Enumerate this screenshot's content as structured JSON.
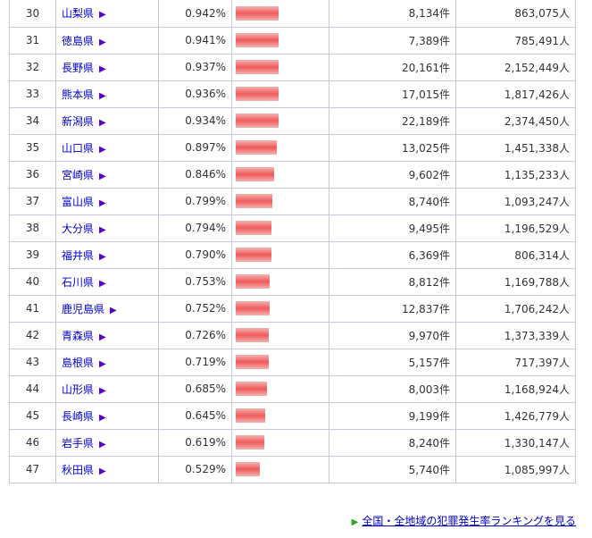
{
  "table": {
    "rows": [
      {
        "rank": "30",
        "pref": "山梨県",
        "rate": "0.942%",
        "rate_value": 0.942,
        "count": "8,134件",
        "population": "863,075人"
      },
      {
        "rank": "31",
        "pref": "徳島県",
        "rate": "0.941%",
        "rate_value": 0.941,
        "count": "7,389件",
        "population": "785,491人"
      },
      {
        "rank": "32",
        "pref": "長野県",
        "rate": "0.937%",
        "rate_value": 0.937,
        "count": "20,161件",
        "population": "2,152,449人"
      },
      {
        "rank": "33",
        "pref": "熊本県",
        "rate": "0.936%",
        "rate_value": 0.936,
        "count": "17,015件",
        "population": "1,817,426人"
      },
      {
        "rank": "34",
        "pref": "新潟県",
        "rate": "0.934%",
        "rate_value": 0.934,
        "count": "22,189件",
        "population": "2,374,450人"
      },
      {
        "rank": "35",
        "pref": "山口県",
        "rate": "0.897%",
        "rate_value": 0.897,
        "count": "13,025件",
        "population": "1,451,338人"
      },
      {
        "rank": "36",
        "pref": "宮崎県",
        "rate": "0.846%",
        "rate_value": 0.846,
        "count": "9,602件",
        "population": "1,135,233人"
      },
      {
        "rank": "37",
        "pref": "富山県",
        "rate": "0.799%",
        "rate_value": 0.799,
        "count": "8,740件",
        "population": "1,093,247人"
      },
      {
        "rank": "38",
        "pref": "大分県",
        "rate": "0.794%",
        "rate_value": 0.794,
        "count": "9,495件",
        "population": "1,196,529人"
      },
      {
        "rank": "39",
        "pref": "福井県",
        "rate": "0.790%",
        "rate_value": 0.79,
        "count": "6,369件",
        "population": "806,314人"
      },
      {
        "rank": "40",
        "pref": "石川県",
        "rate": "0.753%",
        "rate_value": 0.753,
        "count": "8,812件",
        "population": "1,169,788人"
      },
      {
        "rank": "41",
        "pref": "鹿児島県",
        "rate": "0.752%",
        "rate_value": 0.752,
        "count": "12,837件",
        "population": "1,706,242人"
      },
      {
        "rank": "42",
        "pref": "青森県",
        "rate": "0.726%",
        "rate_value": 0.726,
        "count": "9,970件",
        "population": "1,373,339人"
      },
      {
        "rank": "43",
        "pref": "島根県",
        "rate": "0.719%",
        "rate_value": 0.719,
        "count": "5,157件",
        "population": "717,397人"
      },
      {
        "rank": "44",
        "pref": "山形県",
        "rate": "0.685%",
        "rate_value": 0.685,
        "count": "8,003件",
        "population": "1,168,924人"
      },
      {
        "rank": "45",
        "pref": "長崎県",
        "rate": "0.645%",
        "rate_value": 0.645,
        "count": "9,199件",
        "population": "1,426,779人"
      },
      {
        "rank": "46",
        "pref": "岩手県",
        "rate": "0.619%",
        "rate_value": 0.619,
        "count": "8,240件",
        "population": "1,330,147人"
      },
      {
        "rank": "47",
        "pref": "秋田県",
        "rate": "0.529%",
        "rate_value": 0.529,
        "count": "5,740件",
        "population": "1,085,997人"
      }
    ]
  },
  "icons": {
    "pref_arrow": "▶",
    "footer_arrow": "▶"
  },
  "colors": {
    "bar": "#ef5a5a",
    "link": "#0000cc",
    "footer_arrow": "#22aa22"
  },
  "footer": {
    "link_text": "全国・全地域の犯罪発生率ランキングを見る"
  }
}
